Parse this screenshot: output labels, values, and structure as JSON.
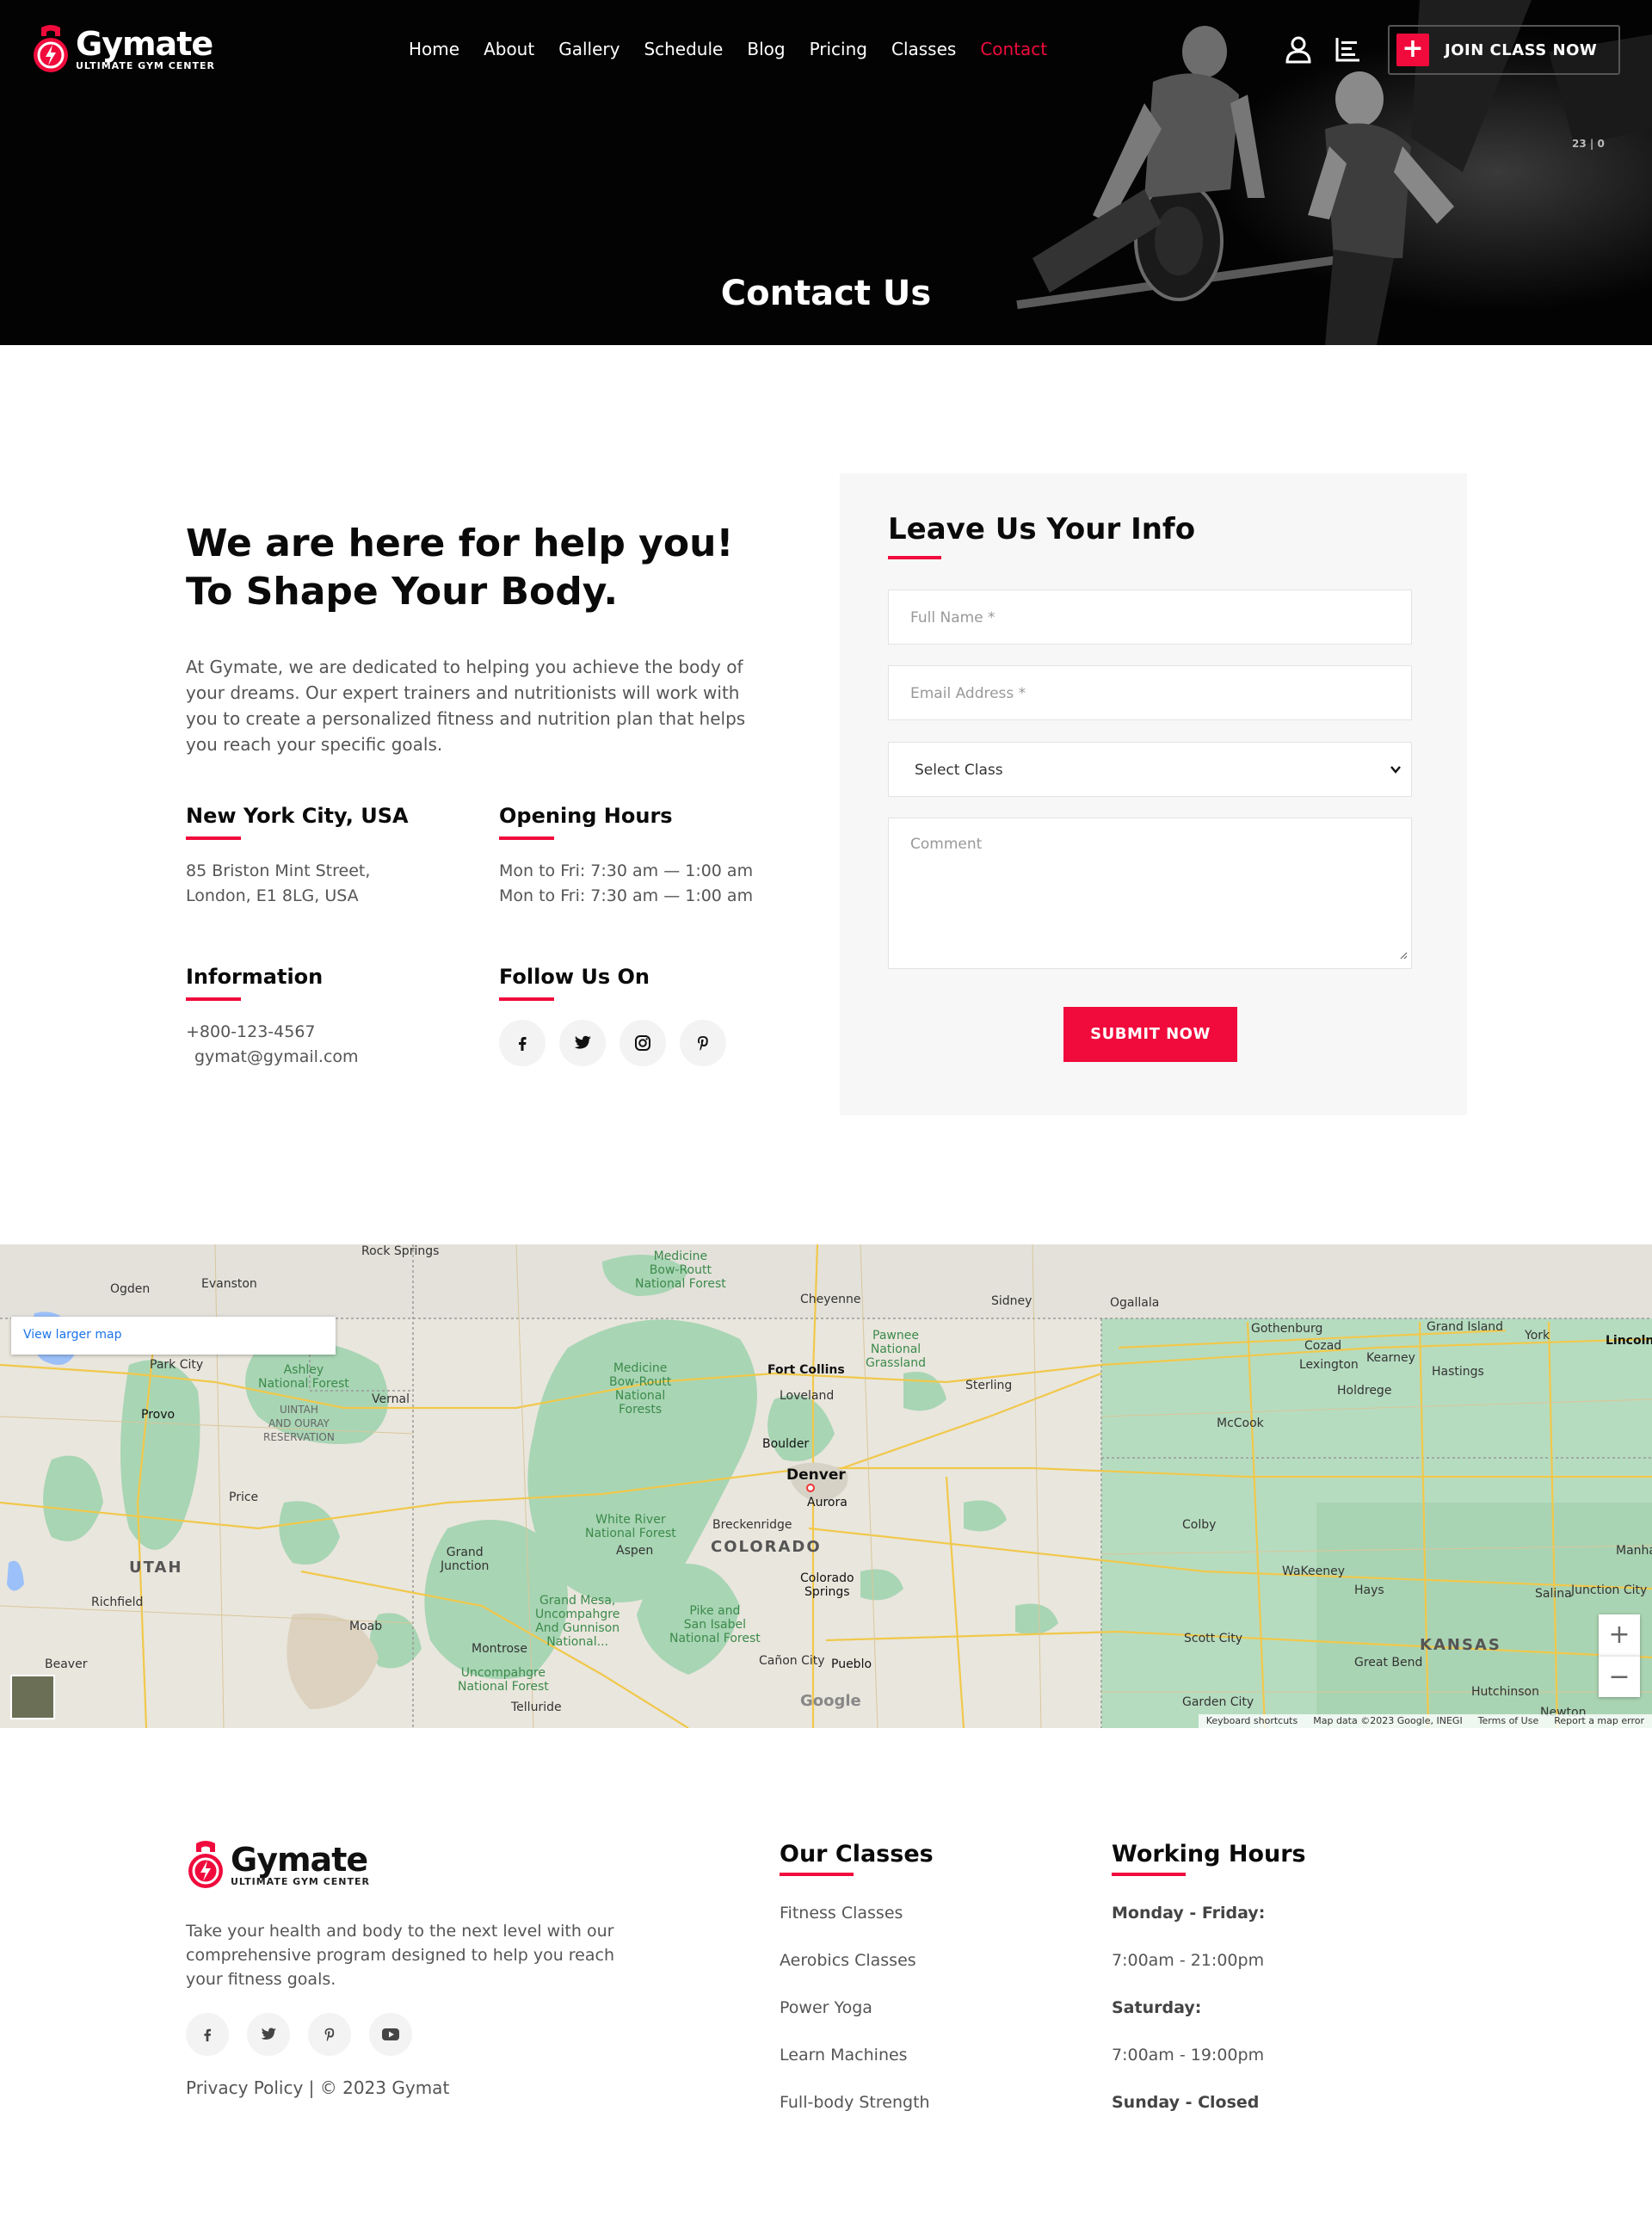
{
  "brand": {
    "name": "Gymate",
    "tagline": "ULTIMATE GYM CENTER"
  },
  "nav": {
    "items": [
      "Home",
      "About",
      "Gallery",
      "Schedule",
      "Blog",
      "Pricing",
      "Classes",
      "Contact"
    ],
    "active": "Contact"
  },
  "header": {
    "join_label": "JOIN CLASS NOW",
    "join_icon": "plus-icon",
    "user_icon": "user-icon",
    "menu_icon": "bars-icon",
    "badge": "23 | 0"
  },
  "hero": {
    "title": "Contact Us"
  },
  "contact": {
    "title": "We are here for help you! To Shape Your Body.",
    "description": "At Gymate, we are dedicated to helping you achieve the body of your dreams. Our expert trainers and nutritionists will work with you to create a personalized fitness and nutrition plan that helps you reach your specific goals.",
    "location": {
      "heading": "New York City, USA",
      "line1": "85 Briston Mint Street,",
      "line2": "London, E1 8LG, USA"
    },
    "hours": {
      "heading": "Opening Hours",
      "line1": "Mon to Fri: 7:30 am — 1:00 am",
      "line2": "Mon to Fri: 7:30 am — 1:00 am"
    },
    "information": {
      "heading": "Information",
      "phone": "+800-123-4567",
      "email": "gymat@gymail.com"
    },
    "follow": {
      "heading": "Follow Us On",
      "icons": [
        "facebook-icon",
        "twitter-icon",
        "instagram-icon",
        "pinterest-icon"
      ]
    }
  },
  "form": {
    "title": "Leave Us Your Info",
    "full_name_placeholder": "Full Name *",
    "email_placeholder": "Email Address *",
    "select_value": "Select Class",
    "comment_placeholder": "Comment",
    "submit_label": "SUBMIT NOW"
  },
  "map": {
    "larger_map_link": "View larger map",
    "zoom_in": "+",
    "zoom_out": "−",
    "google_logo": "Google",
    "attribution": [
      "Keyboard shortcuts",
      "Map data ©2023 Google, INEGI",
      "Terms of Use",
      "Report a map error"
    ],
    "labels": {
      "rock_springs": "Rock Springs",
      "ogden": "Ogden",
      "evanston": "Evanston",
      "medicine_bow": "Medicine\nBow-Routt\nNational Forest",
      "cheyenne": "Cheyenne",
      "sidney": "Sidney",
      "ogallala": "Ogallala",
      "pawnee": "Pawnee\nNational\nGrassland",
      "gothenburg": "Gothenburg",
      "cozad": "Cozad",
      "lexington": "Lexington",
      "kearney": "Kearney",
      "grand_island": "Grand Island",
      "york": "York",
      "lincoln": "Lincoln",
      "hastings": "Hastings",
      "holdrege": "Holdrege",
      "mccook": "McCook",
      "park_city": "Park City",
      "ashley": "Ashley\nNational Forest",
      "vernal": "Vernal",
      "provo": "Provo",
      "uintah": "UINTAH\nAND OURAY\nRESERVATION",
      "medicine_bow_2": "Medicine\nBow-Routt\nNational\nForests",
      "fort_collins": "Fort Collins",
      "loveland": "Loveland",
      "sterling": "Sterling",
      "boulder": "Boulder",
      "denver": "Denver",
      "aurora": "Aurora",
      "price": "Price",
      "white_river": "White River\nNational Forest",
      "aspen": "Aspen",
      "breckenridge": "Breckenridge",
      "colorado": "COLORADO",
      "grand_junction": "Grand\nJunction",
      "utah": "UTAH",
      "colby": "Colby",
      "wakeeney": "WaKeeney",
      "hays": "Hays",
      "salina": "Salina",
      "junction_city": "Junction City",
      "manhattan": "Manhatt",
      "richfield": "Richfield",
      "colorado_springs": "Colorado\nSprings",
      "gmug": "Grand Mesa,\nUncompahgre\nAnd Gunnison\nNational...",
      "pike": "Pike and\nSan Isabel\nNational Forest",
      "moab": "Moab",
      "montrose": "Montrose",
      "scott_city": "Scott City",
      "kansas": "KANSAS",
      "great_bend": "Great Bend",
      "canon_city": "Cañon City",
      "pueblo": "Pueblo",
      "uncompahgre": "Uncompahgre\nNational Forest",
      "hutchinson": "Hutchinson",
      "beaver": "Beaver",
      "telluride": "Telluride",
      "garden_city": "Garden City",
      "newton": "Newton"
    }
  },
  "footer": {
    "description": "Take your health and body to the next level with our comprehensive program designed to help you reach your fitness goals.",
    "social_icons": [
      "facebook-icon",
      "twitter-icon",
      "pinterest-icon",
      "youtube-icon"
    ],
    "copyright": "Privacy Policy | © 2023 Gymat",
    "classes": {
      "heading": "Our Classes",
      "items": [
        "Fitness Classes",
        "Aerobics Classes",
        "Power Yoga",
        "Learn Machines",
        "Full-body Strength"
      ]
    },
    "hours": {
      "heading": "Working Hours",
      "items": [
        "Monday - Friday:",
        "7:00am - 21:00pm",
        "Saturday:",
        "7:00am - 19:00pm",
        "Sunday - Closed"
      ]
    }
  },
  "colors": {
    "accent": "#f00b3c",
    "dark": "#030303",
    "panel": "#f7f7f7",
    "map_green": "#a8d5b4",
    "map_land": "#e9e6dd"
  }
}
